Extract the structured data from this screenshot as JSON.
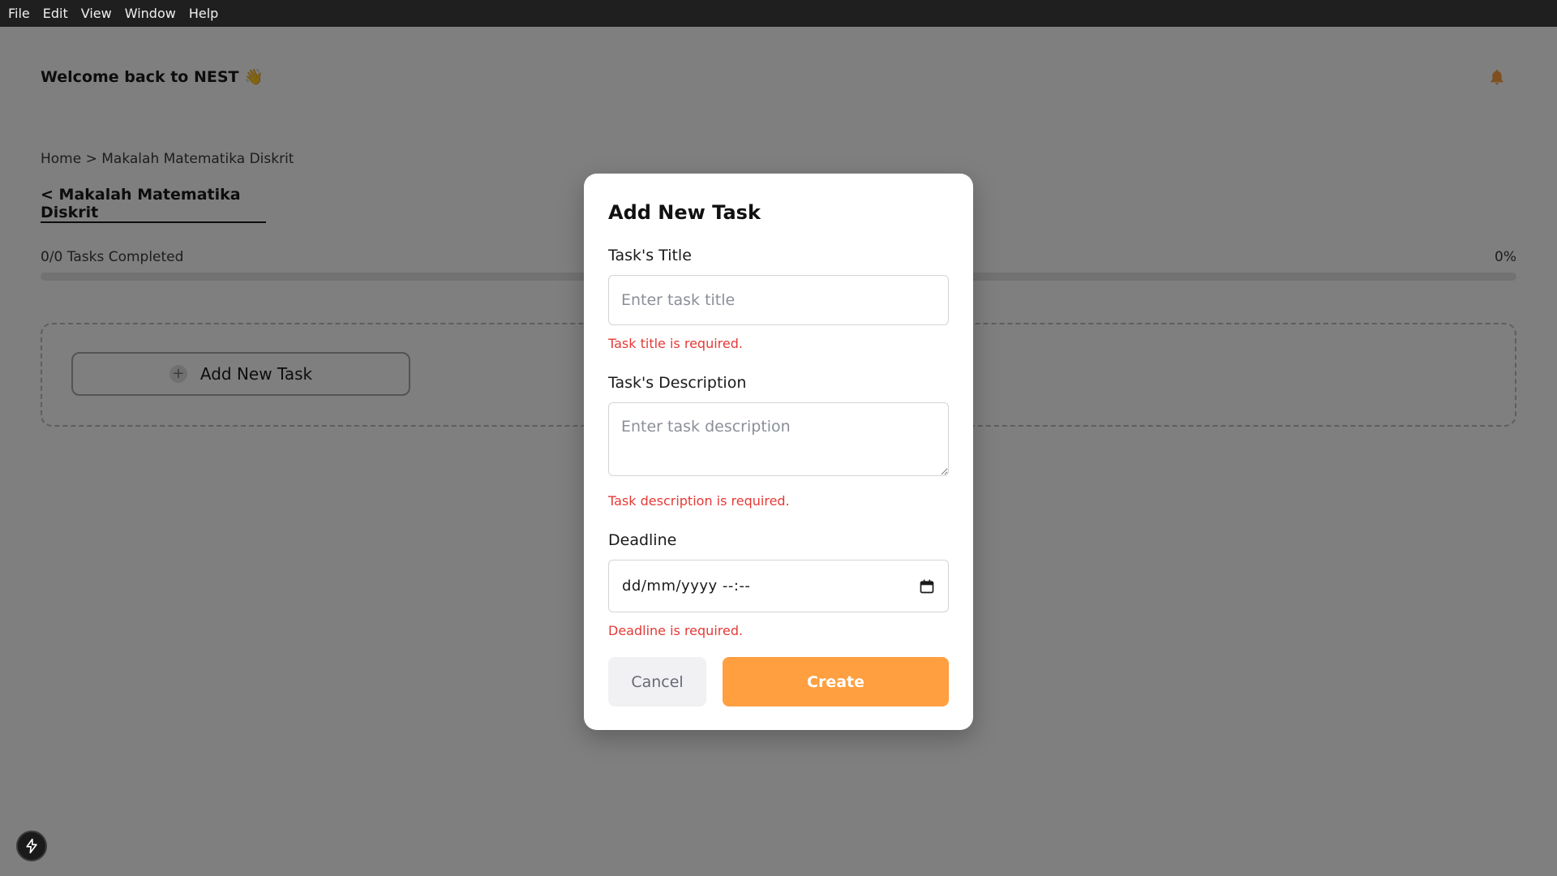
{
  "menubar": {
    "items": [
      "File",
      "Edit",
      "View",
      "Window",
      "Help"
    ]
  },
  "header": {
    "welcome": "Welcome back to NEST 👋",
    "notification_icon": "bell-icon"
  },
  "breadcrumb": "Home > Makalah Matematika Diskrit",
  "project": {
    "back_title": "< Makalah Matematika Diskrit"
  },
  "progress": {
    "label": "0/0 Tasks Completed",
    "percent_text": "0%",
    "fraction": 0
  },
  "task_area": {
    "add_button_label": "Add New Task"
  },
  "modal": {
    "title": "Add New Task",
    "title_label": "Task's Title",
    "title_placeholder": "Enter task title",
    "title_value": "",
    "title_error": "Task title is required.",
    "description_label": "Task's Description",
    "description_placeholder": "Enter task description",
    "description_value": "",
    "description_error": "Task description is required.",
    "deadline_label": "Deadline",
    "deadline_placeholder": "dd/mm/yyyy --:--",
    "deadline_error": "Deadline is required.",
    "cancel_label": "Cancel",
    "create_label": "Create"
  },
  "colors": {
    "accent": "#ff9f40",
    "error": "#e53935",
    "menubar": "#1f1f1f"
  }
}
